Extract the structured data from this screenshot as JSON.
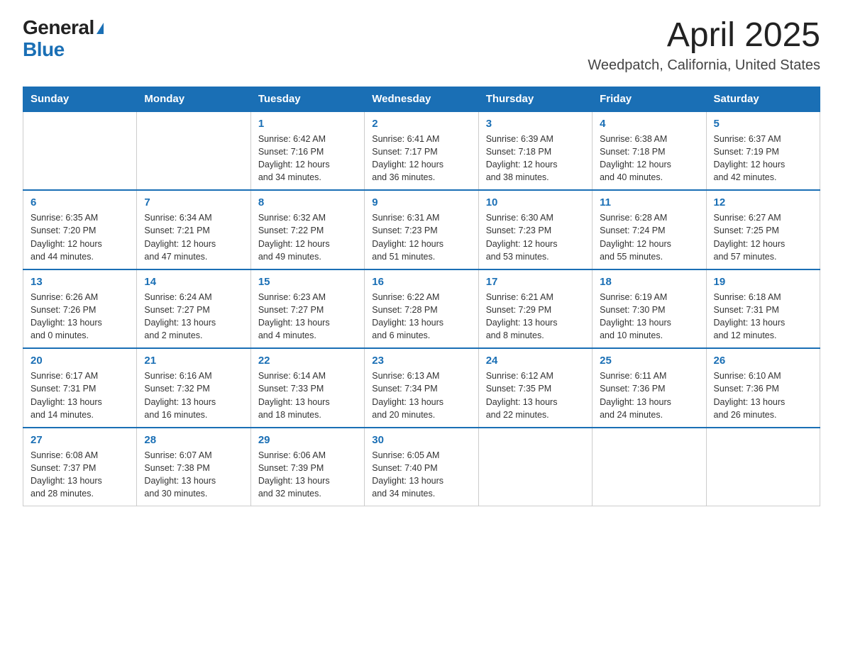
{
  "header": {
    "logo_general": "General",
    "logo_blue": "Blue",
    "month": "April 2025",
    "location": "Weedpatch, California, United States"
  },
  "days_of_week": [
    "Sunday",
    "Monday",
    "Tuesday",
    "Wednesday",
    "Thursday",
    "Friday",
    "Saturday"
  ],
  "weeks": [
    [
      {
        "day": "",
        "info": ""
      },
      {
        "day": "",
        "info": ""
      },
      {
        "day": "1",
        "info": "Sunrise: 6:42 AM\nSunset: 7:16 PM\nDaylight: 12 hours\nand 34 minutes."
      },
      {
        "day": "2",
        "info": "Sunrise: 6:41 AM\nSunset: 7:17 PM\nDaylight: 12 hours\nand 36 minutes."
      },
      {
        "day": "3",
        "info": "Sunrise: 6:39 AM\nSunset: 7:18 PM\nDaylight: 12 hours\nand 38 minutes."
      },
      {
        "day": "4",
        "info": "Sunrise: 6:38 AM\nSunset: 7:18 PM\nDaylight: 12 hours\nand 40 minutes."
      },
      {
        "day": "5",
        "info": "Sunrise: 6:37 AM\nSunset: 7:19 PM\nDaylight: 12 hours\nand 42 minutes."
      }
    ],
    [
      {
        "day": "6",
        "info": "Sunrise: 6:35 AM\nSunset: 7:20 PM\nDaylight: 12 hours\nand 44 minutes."
      },
      {
        "day": "7",
        "info": "Sunrise: 6:34 AM\nSunset: 7:21 PM\nDaylight: 12 hours\nand 47 minutes."
      },
      {
        "day": "8",
        "info": "Sunrise: 6:32 AM\nSunset: 7:22 PM\nDaylight: 12 hours\nand 49 minutes."
      },
      {
        "day": "9",
        "info": "Sunrise: 6:31 AM\nSunset: 7:23 PM\nDaylight: 12 hours\nand 51 minutes."
      },
      {
        "day": "10",
        "info": "Sunrise: 6:30 AM\nSunset: 7:23 PM\nDaylight: 12 hours\nand 53 minutes."
      },
      {
        "day": "11",
        "info": "Sunrise: 6:28 AM\nSunset: 7:24 PM\nDaylight: 12 hours\nand 55 minutes."
      },
      {
        "day": "12",
        "info": "Sunrise: 6:27 AM\nSunset: 7:25 PM\nDaylight: 12 hours\nand 57 minutes."
      }
    ],
    [
      {
        "day": "13",
        "info": "Sunrise: 6:26 AM\nSunset: 7:26 PM\nDaylight: 13 hours\nand 0 minutes."
      },
      {
        "day": "14",
        "info": "Sunrise: 6:24 AM\nSunset: 7:27 PM\nDaylight: 13 hours\nand 2 minutes."
      },
      {
        "day": "15",
        "info": "Sunrise: 6:23 AM\nSunset: 7:27 PM\nDaylight: 13 hours\nand 4 minutes."
      },
      {
        "day": "16",
        "info": "Sunrise: 6:22 AM\nSunset: 7:28 PM\nDaylight: 13 hours\nand 6 minutes."
      },
      {
        "day": "17",
        "info": "Sunrise: 6:21 AM\nSunset: 7:29 PM\nDaylight: 13 hours\nand 8 minutes."
      },
      {
        "day": "18",
        "info": "Sunrise: 6:19 AM\nSunset: 7:30 PM\nDaylight: 13 hours\nand 10 minutes."
      },
      {
        "day": "19",
        "info": "Sunrise: 6:18 AM\nSunset: 7:31 PM\nDaylight: 13 hours\nand 12 minutes."
      }
    ],
    [
      {
        "day": "20",
        "info": "Sunrise: 6:17 AM\nSunset: 7:31 PM\nDaylight: 13 hours\nand 14 minutes."
      },
      {
        "day": "21",
        "info": "Sunrise: 6:16 AM\nSunset: 7:32 PM\nDaylight: 13 hours\nand 16 minutes."
      },
      {
        "day": "22",
        "info": "Sunrise: 6:14 AM\nSunset: 7:33 PM\nDaylight: 13 hours\nand 18 minutes."
      },
      {
        "day": "23",
        "info": "Sunrise: 6:13 AM\nSunset: 7:34 PM\nDaylight: 13 hours\nand 20 minutes."
      },
      {
        "day": "24",
        "info": "Sunrise: 6:12 AM\nSunset: 7:35 PM\nDaylight: 13 hours\nand 22 minutes."
      },
      {
        "day": "25",
        "info": "Sunrise: 6:11 AM\nSunset: 7:36 PM\nDaylight: 13 hours\nand 24 minutes."
      },
      {
        "day": "26",
        "info": "Sunrise: 6:10 AM\nSunset: 7:36 PM\nDaylight: 13 hours\nand 26 minutes."
      }
    ],
    [
      {
        "day": "27",
        "info": "Sunrise: 6:08 AM\nSunset: 7:37 PM\nDaylight: 13 hours\nand 28 minutes."
      },
      {
        "day": "28",
        "info": "Sunrise: 6:07 AM\nSunset: 7:38 PM\nDaylight: 13 hours\nand 30 minutes."
      },
      {
        "day": "29",
        "info": "Sunrise: 6:06 AM\nSunset: 7:39 PM\nDaylight: 13 hours\nand 32 minutes."
      },
      {
        "day": "30",
        "info": "Sunrise: 6:05 AM\nSunset: 7:40 PM\nDaylight: 13 hours\nand 34 minutes."
      },
      {
        "day": "",
        "info": ""
      },
      {
        "day": "",
        "info": ""
      },
      {
        "day": "",
        "info": ""
      }
    ]
  ]
}
